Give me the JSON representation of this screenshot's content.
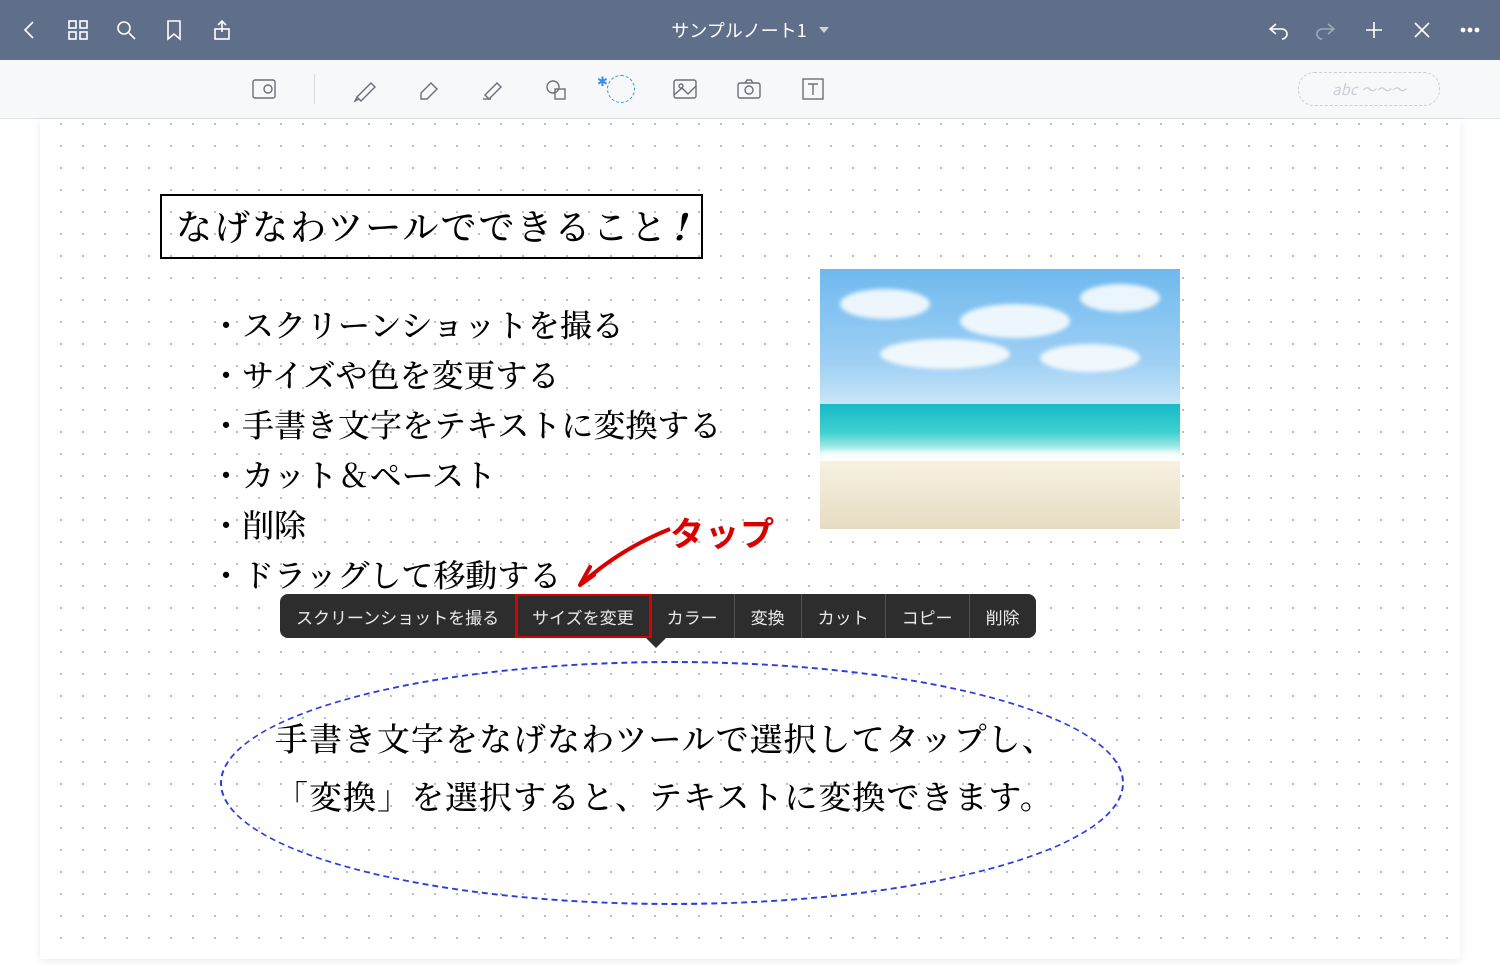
{
  "navbar": {
    "title": "サンプルノート1"
  },
  "abc_placeholder": "abc ～～～",
  "note": {
    "title": "なげなわツールでできること",
    "title_mark": "!",
    "bullets": [
      "・スクリーンショットを撮る",
      "・サイズや色を変更する",
      "・手書き文字をテキストに変換する",
      "・カット＆ペースト",
      "・削除",
      "・ドラッグして移動する"
    ]
  },
  "annotation": {
    "tap_label": "タップ",
    "highlighted_item": "サイズを変更"
  },
  "context_menu": [
    "スクリーンショットを撮る",
    "サイズを変更",
    "カラー",
    "変換",
    "カット",
    "コピー",
    "削除"
  ],
  "selection_text": {
    "line1": "手書き文字をなげなわツールで選択してタップし、",
    "line2": "「変換」を選択すると、テキストに変換できます。"
  }
}
